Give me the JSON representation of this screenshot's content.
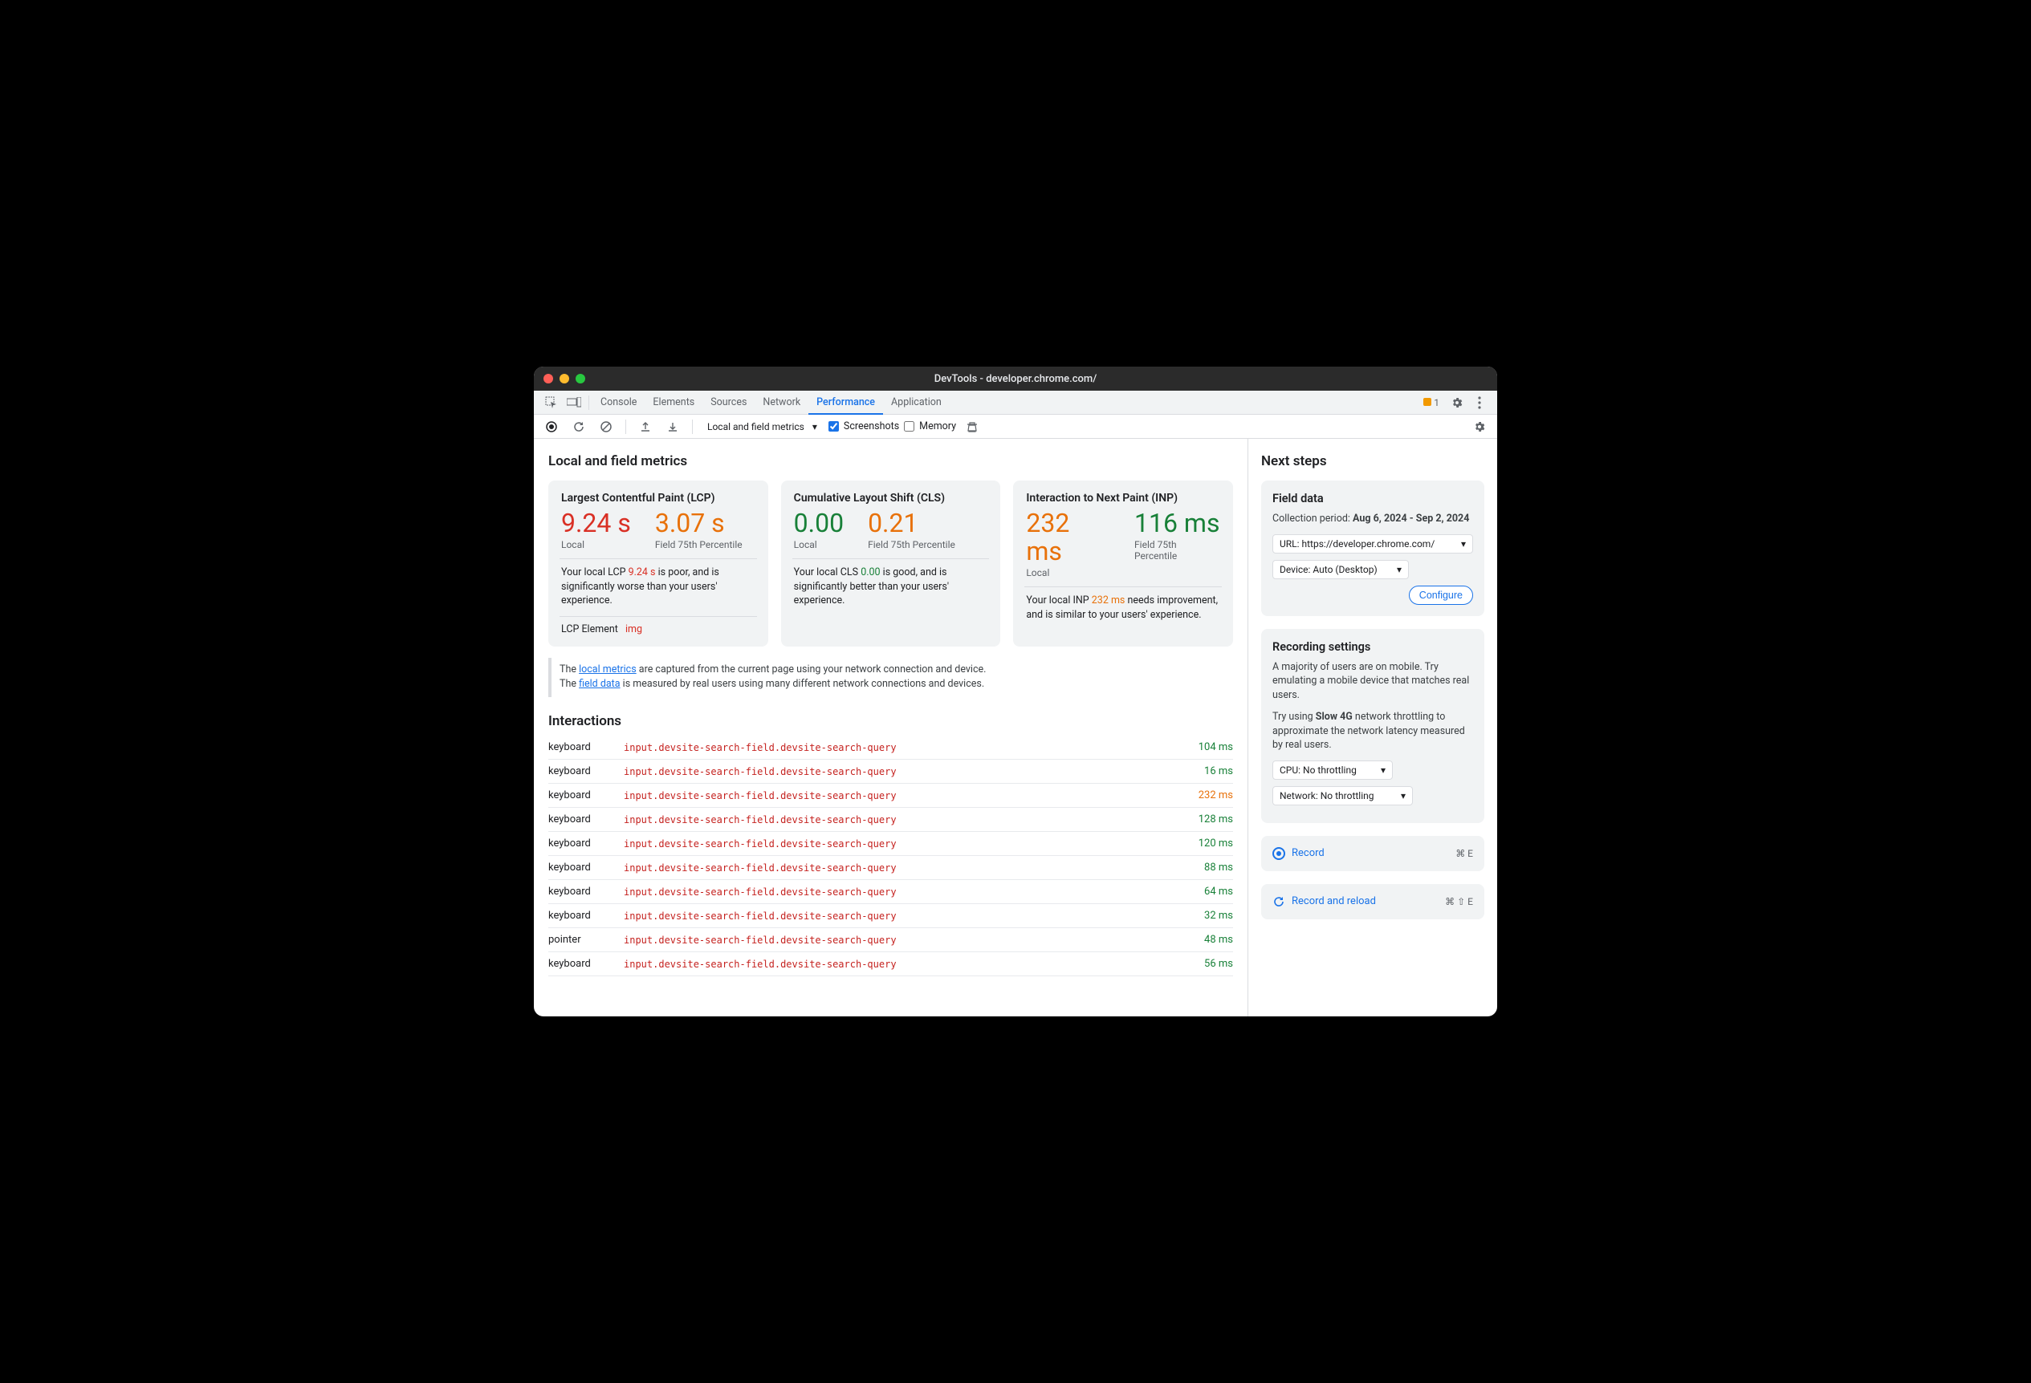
{
  "window": {
    "title": "DevTools - developer.chrome.com/"
  },
  "tabs": {
    "items": [
      "Console",
      "Elements",
      "Sources",
      "Network",
      "Performance",
      "Application"
    ],
    "active": "Performance",
    "issues": "1"
  },
  "toolbar": {
    "dropdown": "Local and field metrics",
    "screenshots": "Screenshots",
    "memory": "Memory"
  },
  "main": {
    "heading": "Local and field metrics",
    "metrics": [
      {
        "title": "Largest Contentful Paint (LCP)",
        "local_value": "9.24 s",
        "local_class": "red",
        "local_label": "Local",
        "field_value": "3.07 s",
        "field_class": "orange",
        "field_label": "Field 75th Percentile",
        "text_pre": "Your local LCP ",
        "text_val": "9.24 s",
        "text_val_class": "red",
        "text_post": " is poor, and is significantly worse than your users' experience.",
        "lcp_element_label": "LCP Element",
        "lcp_element_tag": "img"
      },
      {
        "title": "Cumulative Layout Shift (CLS)",
        "local_value": "0.00",
        "local_class": "green",
        "local_label": "Local",
        "field_value": "0.21",
        "field_class": "orange",
        "field_label": "Field 75th Percentile",
        "text_pre": "Your local CLS ",
        "text_val": "0.00",
        "text_val_class": "green",
        "text_post": " is good, and is significantly better than your users' experience."
      },
      {
        "title": "Interaction to Next Paint (INP)",
        "local_value": "232 ms",
        "local_class": "orange",
        "local_label": "Local",
        "field_value": "116 ms",
        "field_class": "green",
        "field_label": "Field 75th Percentile",
        "text_pre": "Your local INP ",
        "text_val": "232 ms",
        "text_val_class": "orange",
        "text_post": " needs improvement, and is similar to your users' experience."
      }
    ],
    "info": {
      "line1_pre": "The ",
      "line1_link": "local metrics",
      "line1_post": " are captured from the current page using your network connection and device.",
      "line2_pre": "The ",
      "line2_link": "field data",
      "line2_post": " is measured by real users using many different network connections and devices."
    },
    "interactions_heading": "Interactions",
    "interactions": [
      {
        "type": "keyboard",
        "selector": "input.devsite-search-field.devsite-search-query",
        "time": "104 ms",
        "tclass": "green"
      },
      {
        "type": "keyboard",
        "selector": "input.devsite-search-field.devsite-search-query",
        "time": "16 ms",
        "tclass": "green"
      },
      {
        "type": "keyboard",
        "selector": "input.devsite-search-field.devsite-search-query",
        "time": "232 ms",
        "tclass": "orange"
      },
      {
        "type": "keyboard",
        "selector": "input.devsite-search-field.devsite-search-query",
        "time": "128 ms",
        "tclass": "green"
      },
      {
        "type": "keyboard",
        "selector": "input.devsite-search-field.devsite-search-query",
        "time": "120 ms",
        "tclass": "green"
      },
      {
        "type": "keyboard",
        "selector": "input.devsite-search-field.devsite-search-query",
        "time": "88 ms",
        "tclass": "green"
      },
      {
        "type": "keyboard",
        "selector": "input.devsite-search-field.devsite-search-query",
        "time": "64 ms",
        "tclass": "green"
      },
      {
        "type": "keyboard",
        "selector": "input.devsite-search-field.devsite-search-query",
        "time": "32 ms",
        "tclass": "green"
      },
      {
        "type": "pointer",
        "selector": "input.devsite-search-field.devsite-search-query",
        "time": "48 ms",
        "tclass": "green"
      },
      {
        "type": "keyboard",
        "selector": "input.devsite-search-field.devsite-search-query",
        "time": "56 ms",
        "tclass": "green"
      }
    ]
  },
  "side": {
    "heading": "Next steps",
    "field": {
      "title": "Field data",
      "period_label": "Collection period: ",
      "period_value": "Aug 6, 2024 - Sep 2, 2024",
      "url_select": "URL: https://developer.chrome.com/",
      "device_select": "Device: Auto (Desktop)",
      "configure": "Configure"
    },
    "recording": {
      "title": "Recording settings",
      "p1_pre": "A majority of users are on mobile. Try emulating a mobile device that matches real users.",
      "p2_pre": "Try using ",
      "p2_bold": "Slow 4G",
      "p2_post": " network throttling to approximate the network latency measured by real users.",
      "cpu_select": "CPU: No throttling",
      "net_select": "Network: No throttling"
    },
    "record": {
      "label": "Record",
      "shortcut": "⌘ E"
    },
    "reload": {
      "label": "Record and reload",
      "shortcut": "⌘ ⇧ E"
    }
  }
}
